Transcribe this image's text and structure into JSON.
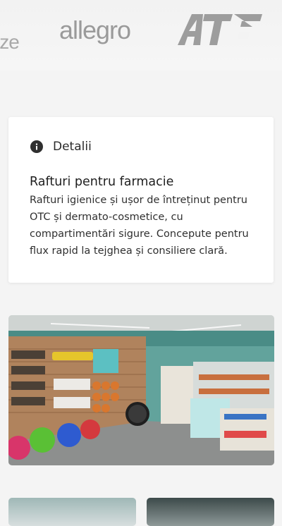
{
  "logos": [
    {
      "name": "partial-logo",
      "text": "ize"
    },
    {
      "name": "allegro-logo",
      "text": "allegro"
    },
    {
      "name": "atb-logo",
      "text": "АТБ"
    }
  ],
  "details_card": {
    "heading": "Detalii",
    "title": "Rafturi pentru farmacie",
    "description": "Rafturi igienice și ușor de întreținut pentru OTC și dermato-cosmetice, cu compartimentări sigure. Concepute pentru flux rapid la tejghea și consiliere clară."
  },
  "gallery": {
    "main_image": "pharmacy-store-interior",
    "thumbnails": [
      "store-interior-thumb-1",
      "store-interior-thumb-2"
    ]
  },
  "colors": {
    "page_bg": "#f4f4f4",
    "logo_gray": "#9a9a9a",
    "wall_teal": "#4a8c86"
  }
}
